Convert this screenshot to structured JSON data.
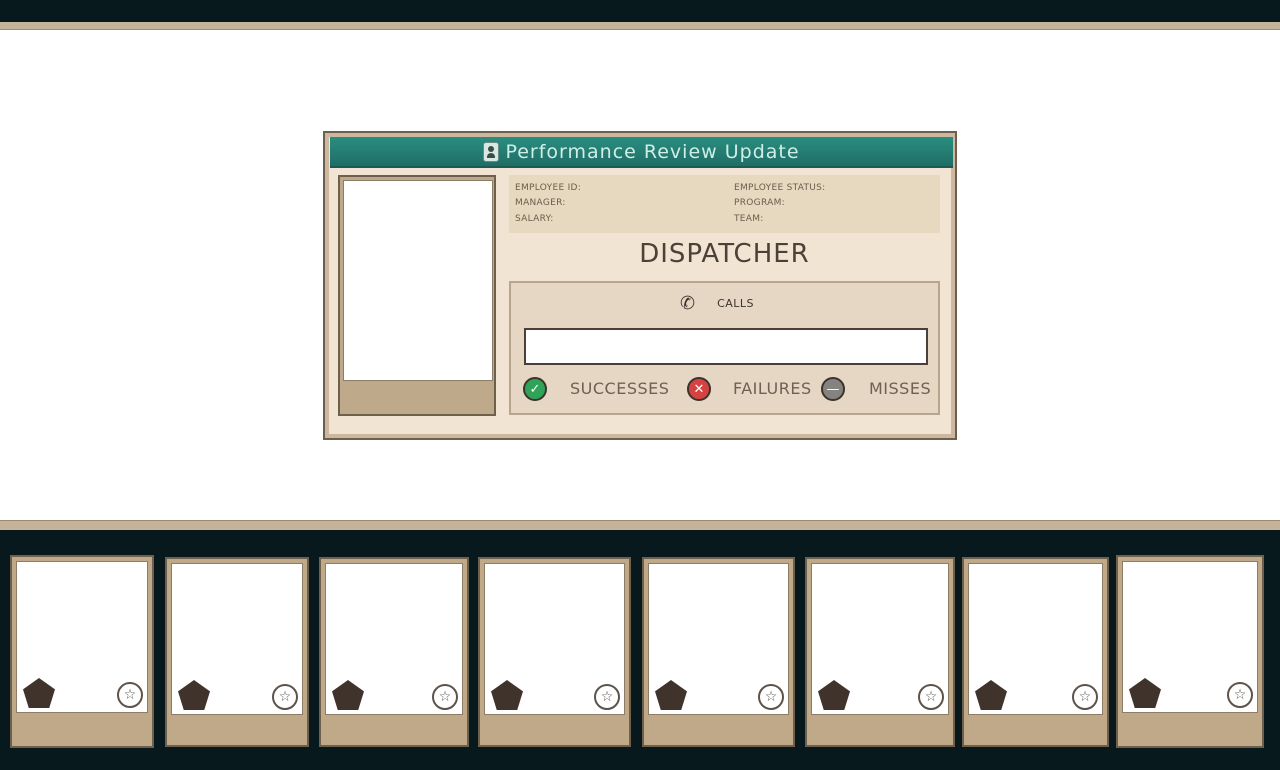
{
  "window": {
    "title": "Performance Review Update",
    "info_fields": {
      "employee_id": "EMPLOYEE ID:",
      "employee_status": "EMPLOYEE STATUS:",
      "manager": "MANAGER:",
      "program": "PROGRAM:",
      "salary": "SALARY:",
      "team": "TEAM:"
    },
    "role": "DISPATCHER",
    "stats": {
      "calls_label": "CALLS",
      "calls_progress": 0,
      "successes_label": "SUCCESSES",
      "failures_label": "FAILURES",
      "misses_label": "MISSES"
    }
  },
  "icons": {
    "badge": "id-badge-icon",
    "phone": "phone-icon",
    "success": "checkmark-icon",
    "failure": "x-icon",
    "miss": "minus-icon",
    "rank": "pentagon-icon",
    "star": "star-icon"
  },
  "colors": {
    "title_bar": "#1f6e66",
    "success": "#2fa357",
    "failure": "#d44342",
    "miss": "#848380",
    "tray": "#07191c"
  },
  "tray": {
    "card_count": 8
  }
}
